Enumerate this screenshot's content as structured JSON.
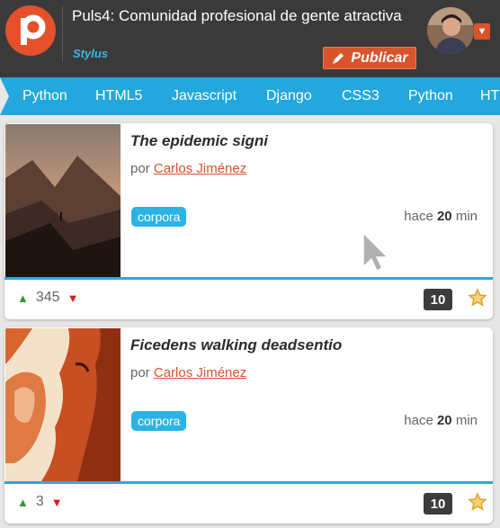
{
  "header": {
    "title": "Puls4: Comunidad profesional de gente atractiva",
    "subtitle": "Stylus",
    "publish_label": "Publicar",
    "logo_letter": "p"
  },
  "nav": {
    "items": [
      "Python",
      "HTML5",
      "Javascript",
      "Django",
      "CSS3",
      "Python",
      "HT"
    ]
  },
  "posts": [
    {
      "title": "The epidemic signi",
      "by_prefix": "por",
      "author": "Carlos Jiménez",
      "tag": "corpora",
      "time_prefix": "hace",
      "time_value": "20",
      "time_unit": "min",
      "votes": "345",
      "comments": "10"
    },
    {
      "title": "Ficedens walking deadsentio",
      "by_prefix": "por",
      "author": "Carlos Jiménez",
      "tag": "corpora",
      "time_prefix": "hace",
      "time_value": "20",
      "time_unit": "min",
      "votes": "3",
      "comments": "10"
    }
  ],
  "colors": {
    "header_bg": "#3a3a3a",
    "accent_orange": "#d9532b",
    "nav_blue": "#23a7dc",
    "tag_blue": "#2bb4e3",
    "upvote_green": "#2f9a2f",
    "downvote_red": "#d21d1d"
  },
  "icons": {
    "logo": "p-logo-icon",
    "publish": "pen-icon",
    "avatar_menu": "caret-down-icon",
    "upvote": "triangle-up-icon",
    "downvote": "triangle-down-icon",
    "favorite": "star-icon",
    "cursor": "mouse-pointer-icon"
  }
}
